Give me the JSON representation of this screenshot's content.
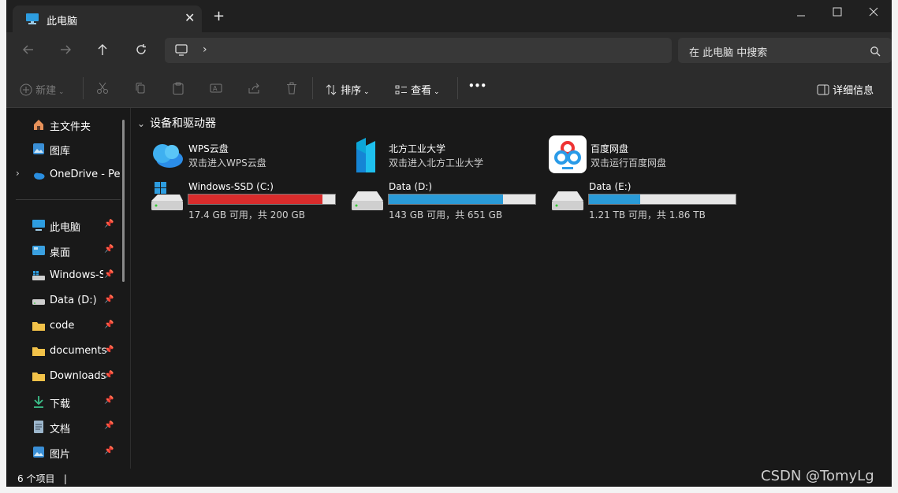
{
  "window": {
    "tab_title": "此电脑",
    "close_tab": "✕",
    "new_tab": "+",
    "minimize": "─",
    "maximize": "☐",
    "close": "✕"
  },
  "navbar": {
    "back": "←",
    "forward": "→",
    "up": "↑",
    "refresh": "⟳",
    "address_chevron": "›",
    "search_placeholder": "在 此电脑 中搜索"
  },
  "toolbar": {
    "new_label": "新建",
    "sort_label": "排序",
    "view_label": "查看",
    "more_label": "•••",
    "details_label": "详细信息"
  },
  "sidebar": {
    "items": [
      {
        "label": "主文件夹",
        "icon": "home-icon",
        "pinned": false
      },
      {
        "label": "图库",
        "icon": "gallery-icon",
        "pinned": false
      },
      {
        "label": "OneDrive - Per",
        "icon": "onedrive-icon",
        "pinned": false,
        "expandable": true
      },
      {
        "label": "此电脑",
        "icon": "computer-icon",
        "pinned": true
      },
      {
        "label": "桌面",
        "icon": "desktop-icon",
        "pinned": true
      },
      {
        "label": "Windows-SSD",
        "icon": "drive-icon",
        "pinned": true
      },
      {
        "label": "Data (D:)",
        "icon": "drive-icon",
        "pinned": true
      },
      {
        "label": "code",
        "icon": "folder-icon",
        "pinned": true
      },
      {
        "label": "documents",
        "icon": "folder-icon",
        "pinned": true
      },
      {
        "label": "Downloads",
        "icon": "folder-icon",
        "pinned": true
      },
      {
        "label": "下载",
        "icon": "download-icon",
        "pinned": true
      },
      {
        "label": "文档",
        "icon": "document-icon",
        "pinned": true
      },
      {
        "label": "图片",
        "icon": "pictures-icon",
        "pinned": true
      }
    ]
  },
  "main": {
    "section_title": "设备和驱动器",
    "apps": [
      {
        "name": "WPS云盘",
        "sub": "双击进入WPS云盘",
        "icon": "wps-cloud-icon"
      },
      {
        "name": "北方工业大学",
        "sub": "双击进入北方工业大学",
        "icon": "ncut-icon"
      },
      {
        "name": "百度网盘",
        "sub": "双击运行百度网盘",
        "icon": "baidu-netdisk-icon"
      }
    ],
    "drives": [
      {
        "name": "Windows-SSD (C:)",
        "free": "17.4 GB 可用，共 200 GB",
        "used_fraction": 0.913,
        "bar_color": "#d92c2c"
      },
      {
        "name": "Data (D:)",
        "free": "143 GB 可用，共 651 GB",
        "used_fraction": 0.78,
        "bar_color": "#2a9bd8"
      },
      {
        "name": "Data (E:)",
        "free": "1.21 TB 可用，共 1.86 TB",
        "used_fraction": 0.35,
        "bar_color": "#2a9bd8"
      }
    ]
  },
  "status": {
    "count": "6 个项目",
    "separator": "|"
  },
  "watermark": "CSDN @TomyLg"
}
